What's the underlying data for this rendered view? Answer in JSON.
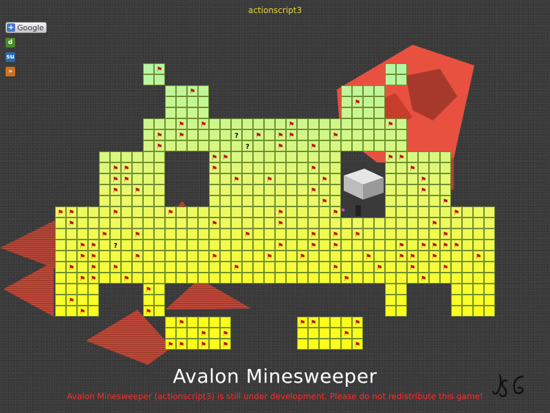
{
  "header": {
    "label": "actionscript3"
  },
  "share": {
    "google_label": "Google",
    "icons": [
      "delicious-icon",
      "stumbleupon-icon",
      "rss-icon"
    ]
  },
  "game": {
    "title": "Avalon Minesweeper",
    "notice": "Avalon Minesweeper (actionscript3) is still under development. Please do not redistribute this game!",
    "signature": "JSG",
    "colors": {
      "cell_top": "#b3f5a8",
      "cell_bottom": "#ffff1a",
      "cell_border": "#6f8f2e",
      "pyramid": "#c24a3a",
      "relief": "#e85040",
      "notice": "#ff2a2a",
      "header": "#e8d23a"
    },
    "flag_glyph": "⚑",
    "question_glyph": "?"
  }
}
